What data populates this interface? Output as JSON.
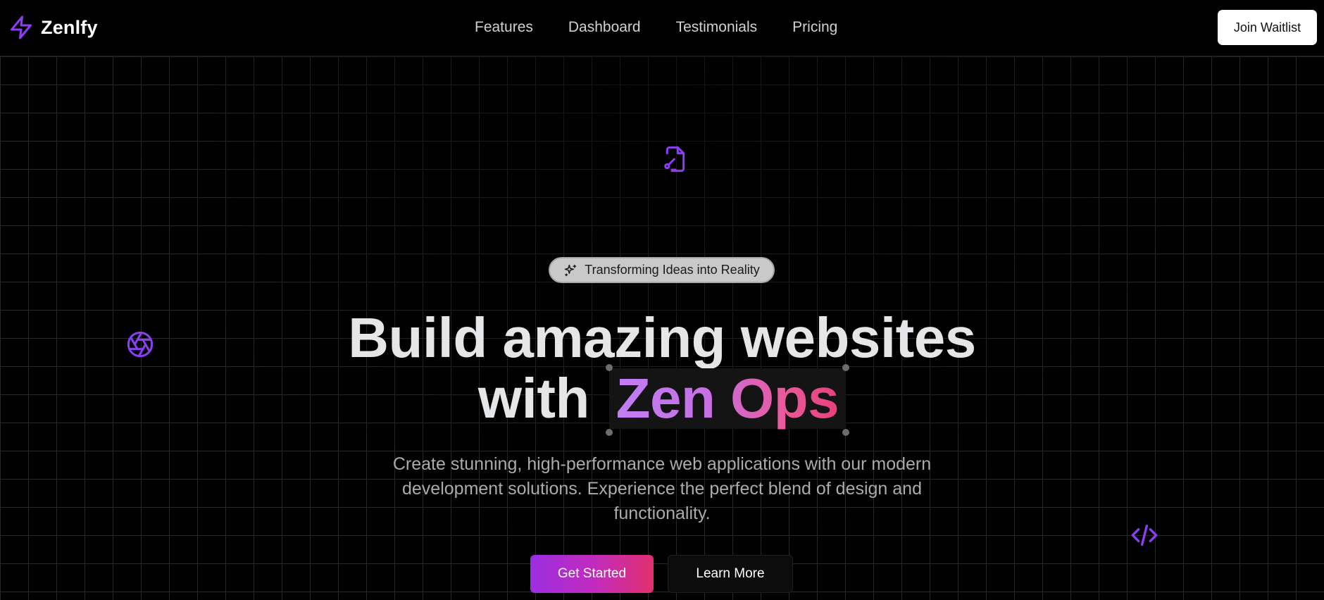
{
  "brand": {
    "name": "Zenlfy",
    "icon": "lightning-bolt-icon",
    "accent_color": "#8b3ff0"
  },
  "nav": {
    "items": [
      {
        "label": "Features"
      },
      {
        "label": "Dashboard"
      },
      {
        "label": "Testimonials"
      },
      {
        "label": "Pricing"
      }
    ]
  },
  "header": {
    "cta_label": "Join Waitlist"
  },
  "hero": {
    "badge_icon": "sparkles-icon",
    "badge_text": "Transforming Ideas into Reality",
    "headline_line1": "Build amazing websites",
    "headline_line2_prefix": "with",
    "headline_highlight": "Zen Ops",
    "subtext": "Create stunning, high-performance web applications with our modern development solutions. Experience the perfect blend of design and functionality.",
    "primary_cta": "Get Started",
    "secondary_cta": "Learn More",
    "gradient_colors": [
      "#9b2ee0",
      "#e0306e"
    ]
  },
  "decorations": {
    "icons": [
      "file-signature-icon",
      "aperture-icon",
      "code-icon"
    ]
  }
}
